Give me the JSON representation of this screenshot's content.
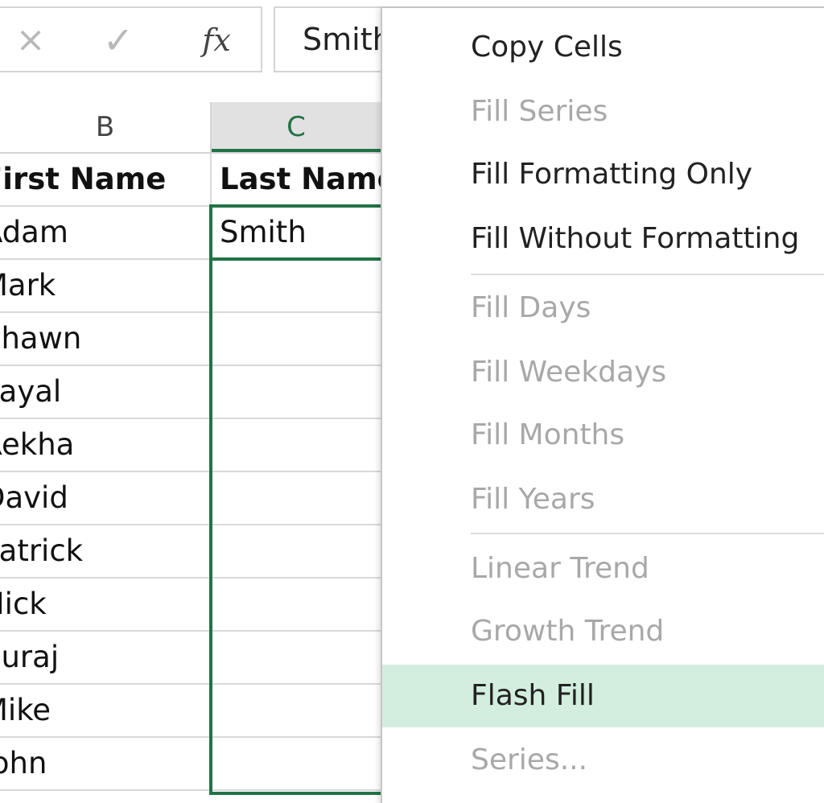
{
  "formula_bar": {
    "cancel_icon": "×",
    "enter_icon": "✓",
    "fx_label": "fx",
    "value": "Smith"
  },
  "columns": {
    "b": "B",
    "c": "C"
  },
  "rows": [
    {
      "b": "First Name",
      "c": "Last Name"
    },
    {
      "b": "Adam",
      "c": "Smith"
    },
    {
      "b": "Mark",
      "c": ""
    },
    {
      "b": "Shawn",
      "c": ""
    },
    {
      "b": "Payal",
      "c": ""
    },
    {
      "b": "Rekha",
      "c": ""
    },
    {
      "b": "David",
      "c": ""
    },
    {
      "b": "Patrick",
      "c": ""
    },
    {
      "b": "Nick",
      "c": ""
    },
    {
      "b": "Suraj",
      "c": ""
    },
    {
      "b": "Mike",
      "c": ""
    },
    {
      "b": "John",
      "c": ""
    }
  ],
  "context_menu": {
    "items": [
      {
        "label": "Copy Cells",
        "enabled": true
      },
      {
        "label": "Fill Series",
        "enabled": false
      },
      {
        "label": "Fill Formatting Only",
        "enabled": true
      },
      {
        "label": "Fill Without Formatting",
        "enabled": true
      },
      {
        "label": "Fill Days",
        "enabled": false
      },
      {
        "label": "Fill Weekdays",
        "enabled": false
      },
      {
        "label": "Fill Months",
        "enabled": false
      },
      {
        "label": "Fill Years",
        "enabled": false
      },
      {
        "label": "Linear Trend",
        "enabled": false
      },
      {
        "label": "Growth Trend",
        "enabled": false
      },
      {
        "label": "Flash Fill",
        "enabled": true,
        "highlighted": true
      },
      {
        "label": "Series...",
        "enabled": false
      }
    ]
  },
  "colors": {
    "selection_green": "#217346",
    "menu_highlight": "#d3eedf",
    "disabled_text": "#a8a8a8"
  }
}
